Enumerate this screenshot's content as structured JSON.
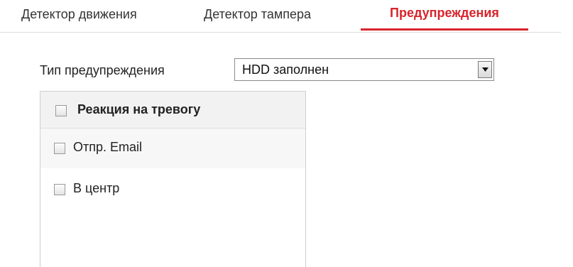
{
  "tabs": [
    {
      "label": "Детектор движения",
      "active": false
    },
    {
      "label": "Детектор тампера",
      "active": false
    },
    {
      "label": "Предупреждения",
      "active": true
    }
  ],
  "accent_color": "#d8242b",
  "alert_type": {
    "label": "Тип предупреждения",
    "selected": "HDD заполнен"
  },
  "linkage": {
    "header": {
      "label": "Реакция на тревогу",
      "checked": false
    },
    "items": [
      {
        "label": "Отпр. Email",
        "checked": false
      },
      {
        "label": "В центр",
        "checked": false
      }
    ]
  }
}
